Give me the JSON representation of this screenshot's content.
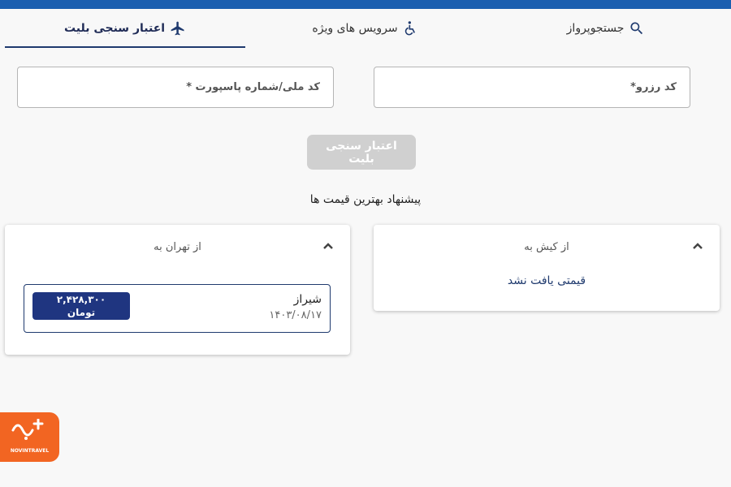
{
  "tabs": [
    {
      "label": "جستجوپرواز",
      "icon": "search-icon"
    },
    {
      "label": "سرویس های ویژه",
      "icon": "wheelchair-icon"
    },
    {
      "label": "اعتبار سنجی بلیت",
      "icon": "airplane-icon",
      "active": true
    }
  ],
  "form": {
    "reserve_placeholder": "کد رزرو*",
    "national_placeholder": "کد ملی/شماره پاسپورت *",
    "submit_label": "اعتبار سنجی بلیت"
  },
  "best_price": {
    "title": "پیشنهاد بهترین قیمت ها",
    "from_kish": {
      "header": "از کیش به",
      "empty_text": "قیمتی یافت نشد"
    },
    "from_tehran": {
      "header": "از تهران به",
      "fares": [
        {
          "city": "شیراز",
          "date": "۱۴۰۳/۰۸/۱۷",
          "price": "۲,۴۲۸,۳۰۰",
          "currency": "تومان"
        }
      ]
    }
  },
  "logo": {
    "text": "NOVINTRAVEL"
  },
  "colors": {
    "brand_blue": "#1b5fb0",
    "navy": "#1f3580",
    "logo_orange": "#f26522"
  }
}
